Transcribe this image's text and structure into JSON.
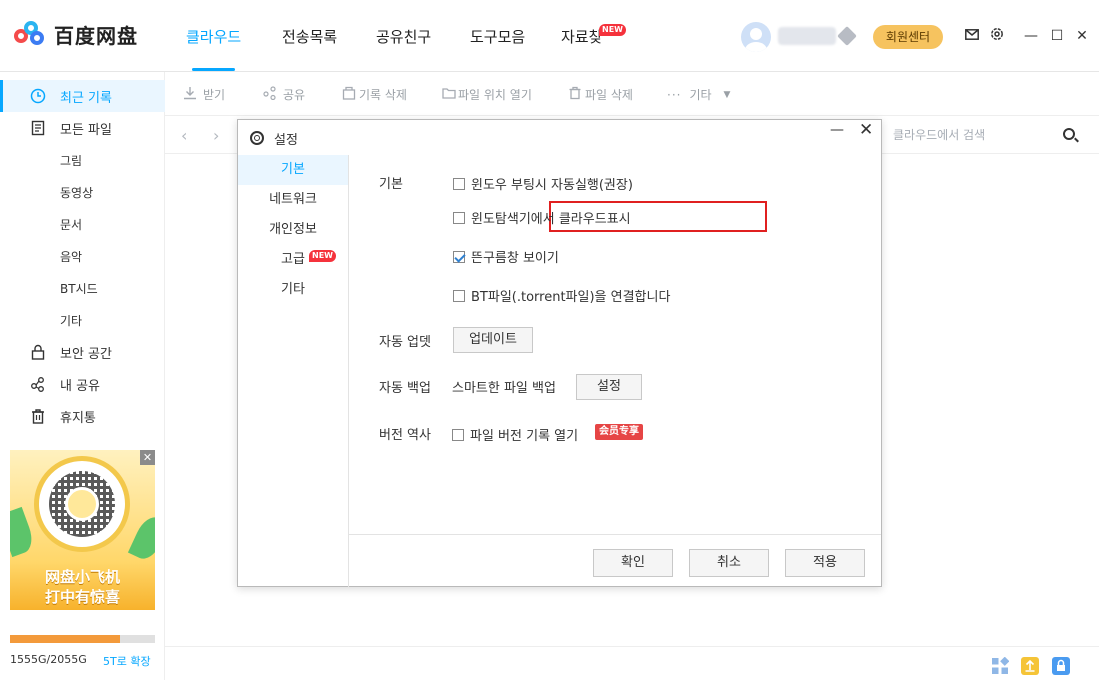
{
  "app": {
    "logo_text": "百度网盘",
    "nav_tabs": [
      {
        "label": "클라우드",
        "active": true
      },
      {
        "label": "전송목록"
      },
      {
        "label": "공유친구"
      },
      {
        "label": "도구모음"
      },
      {
        "label": "자료찾",
        "badge": "NEW"
      }
    ],
    "member_center": "회원센터",
    "accent_color": "#06a7ff"
  },
  "sidebar": {
    "items": [
      {
        "label": "최근 기록",
        "icon": "clock-icon",
        "active": true
      },
      {
        "label": "모든 파일",
        "icon": "file-icon"
      }
    ],
    "sub_items": [
      "그림",
      "동영상",
      "문서",
      "음악",
      "BT시드",
      "기타"
    ],
    "items2": [
      {
        "label": "보안 공간",
        "icon": "lock-icon"
      },
      {
        "label": "내 공유",
        "icon": "share-icon"
      },
      {
        "label": "휴지통",
        "icon": "trash-icon"
      }
    ],
    "ad": {
      "line1": "网盘小飞机",
      "line2": "打中有惊喜",
      "close": "✕"
    },
    "storage": {
      "used_fraction": 0.7567,
      "text": "1555G/2055G",
      "expand": "5T로 확장"
    }
  },
  "toolbar": {
    "items": [
      "받기",
      "공유",
      "기록 삭제",
      "파일 위치 열기",
      "파일 삭제",
      "기타"
    ]
  },
  "pathbar": {
    "back": "‹",
    "forward": "›",
    "search_placeholder": "클라우드에서 검색"
  },
  "dialog": {
    "title": "설정",
    "minimize": "—",
    "close": "✕",
    "nav": [
      {
        "label": "기본",
        "active": true
      },
      {
        "label": "네트워크"
      },
      {
        "label": "개인정보"
      },
      {
        "label": "고급",
        "badge": "NEW"
      },
      {
        "label": "기타"
      }
    ],
    "basic_label": "기본",
    "options": [
      {
        "label": "윈도우 부팅시 자동실행(권장)",
        "checked": false
      },
      {
        "label": "윈도탐색기에서 클라우드표시",
        "checked": false,
        "highlighted": true
      },
      {
        "label": "뜬구름창 보이기",
        "checked": true
      },
      {
        "label": "BT파일(.torrent파일)을 연결합니다",
        "checked": false
      }
    ],
    "auto_update_label": "자동 업뎃",
    "update_button": "업데이트",
    "auto_backup_label": "자동 백업",
    "smart_backup_text": "스마트한 파일 백업",
    "settings_button": "설정",
    "version_label": "버전 역사",
    "version_option": "파일 버전 기록 열기",
    "vip_tag": "会员专享",
    "buttons": {
      "ok": "확인",
      "cancel": "취소",
      "apply": "적용"
    }
  },
  "window": {
    "minimize": "—",
    "maximize": "☐",
    "close": "✕"
  }
}
